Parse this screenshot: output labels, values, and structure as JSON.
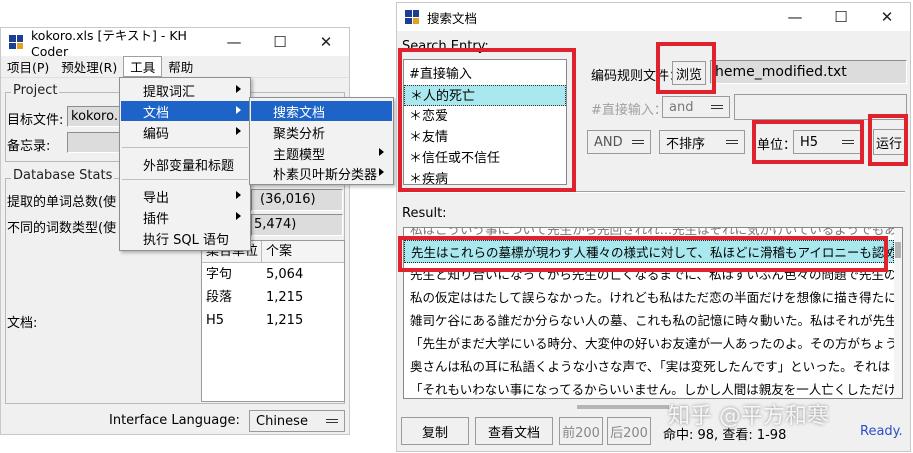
{
  "left": {
    "title": "kokoro.xls [テキスト] - KH Coder",
    "menu": [
      "项目(P)",
      "预处理(R)",
      "工具",
      "帮助"
    ],
    "project_label": "Project",
    "target_file_label": "目标文件:",
    "target_file_value": "kokoro.",
    "memo_label": "备忘录:",
    "db_label": "Database Stats",
    "stats": [
      {
        "label": "提取的单词总数(使",
        "value": "(36,016)"
      },
      {
        "label": "不同的词数类型(使",
        "value": "5,474)"
      }
    ],
    "doc_label": "文档:",
    "table_headers": [
      "集合单位",
      "个案"
    ],
    "table_rows": [
      [
        "字句",
        "5,064"
      ],
      [
        "段落",
        "1,215"
      ],
      [
        "H5",
        "1,215"
      ]
    ],
    "interface_language_label": "Interface Language:",
    "interface_language_value": "Chinese"
  },
  "tools_menu": {
    "items": [
      "提取词汇",
      "文档",
      "编码",
      "外部变量和标题",
      "导出",
      "插件",
      "执行 SQL 语句"
    ]
  },
  "doc_submenu": {
    "items": [
      "搜索文档",
      "聚类分析",
      "主题模型",
      "朴素贝叶斯分类器"
    ]
  },
  "right": {
    "title": "搜索文档",
    "search_entry_label": "Search Entry:",
    "entries": [
      "#直接输入",
      "＊人的死亡",
      "＊恋爱",
      "＊友情",
      "＊信任或不信任",
      "＊疾病"
    ],
    "coding_rule_label": "编码规则文件：",
    "browse_label": "浏览",
    "coding_rule_file": "heme_modified.txt",
    "direct_input_label": "#直接输入：",
    "and_label": "and",
    "and_mode": "AND",
    "sort_mode": "不排序",
    "unit_label": "单位：",
    "unit_value": "H5",
    "run_label": "运行",
    "result_label": "Result:",
    "results": [
      "私はこういう事について先生から先回されれ…先生はそれに気がけいているようでもあり…また全",
      "先生はこれらの墓標が現わす人種々の様式に対して、私ほどに滑稽もアイロニーも認めてないら",
      "先生と知り合いになってから先生の亡くなるまでに、私はずいぶん色々の問題で先生の思想や情",
      "私の仮定ははたして誤らなかった。けれども私はただ恋の半面だけを想像に描き得たに過ぎなかっ",
      "雑司ケ谷にある誰だか分らない人の墓、これも私の記憶に時々動いた。私はそれが先生と深い縁",
      "「先生がまだ大学にいる時分、大変仲の好いお友達が一人あったのよ。その方がちょうど卒業する",
      "奥さんは私の耳に私語くような小さな声で、「実は変死したんです」といった。それは「どうして」と",
      "「それもいわない事になってるからいいません。しかし人間は親友を一人亡くしただけで、そんなに変"
    ],
    "copy_label": "复制",
    "view_doc_label": "查看文档",
    "prev_label": "前200",
    "next_label": "后200",
    "hits_text": "命中: 98, 查看: 1-98",
    "status": "Ready."
  },
  "watermark": "知乎 @平方和寒",
  "colors": {
    "highlight_menu": "#1e64c8",
    "selection_row": "#a8e8ee",
    "annotation_red": "#e0222e"
  },
  "icons": [
    "app-icon",
    "minimize-icon",
    "maximize-icon",
    "close-icon",
    "submenu-arrow-icon",
    "dropdown-arrow-icon"
  ]
}
